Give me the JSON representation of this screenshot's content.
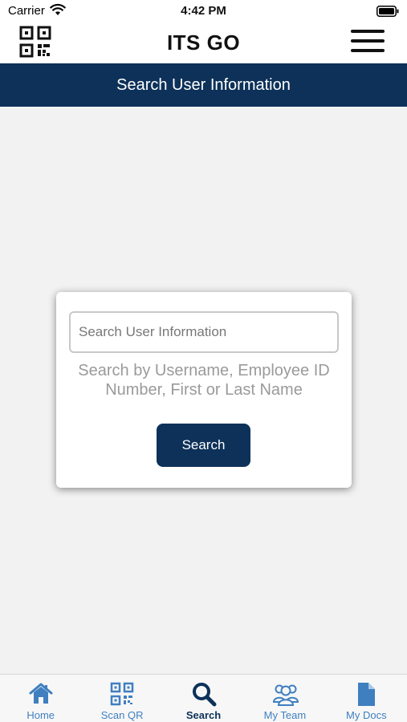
{
  "status_bar": {
    "carrier": "Carrier",
    "time": "4:42 PM"
  },
  "header": {
    "title": "ITS GO"
  },
  "page": {
    "title": "Search User Information"
  },
  "search": {
    "placeholder": "Search User Information",
    "value": "",
    "helper": "Search by Username, Employee ID Number, First or Last Name",
    "button_label": "Search"
  },
  "tabs": [
    {
      "label": "Home",
      "icon": "home-icon",
      "active": false
    },
    {
      "label": "Scan QR",
      "icon": "qr-code-icon",
      "active": false
    },
    {
      "label": "Search",
      "icon": "search-icon",
      "active": true
    },
    {
      "label": "My Team",
      "icon": "team-icon",
      "active": false
    },
    {
      "label": "My Docs",
      "icon": "document-icon",
      "active": false
    }
  ],
  "colors": {
    "primary": "#0d3159",
    "tab_inactive": "#3f7fc0",
    "background": "#f2f2f2"
  }
}
